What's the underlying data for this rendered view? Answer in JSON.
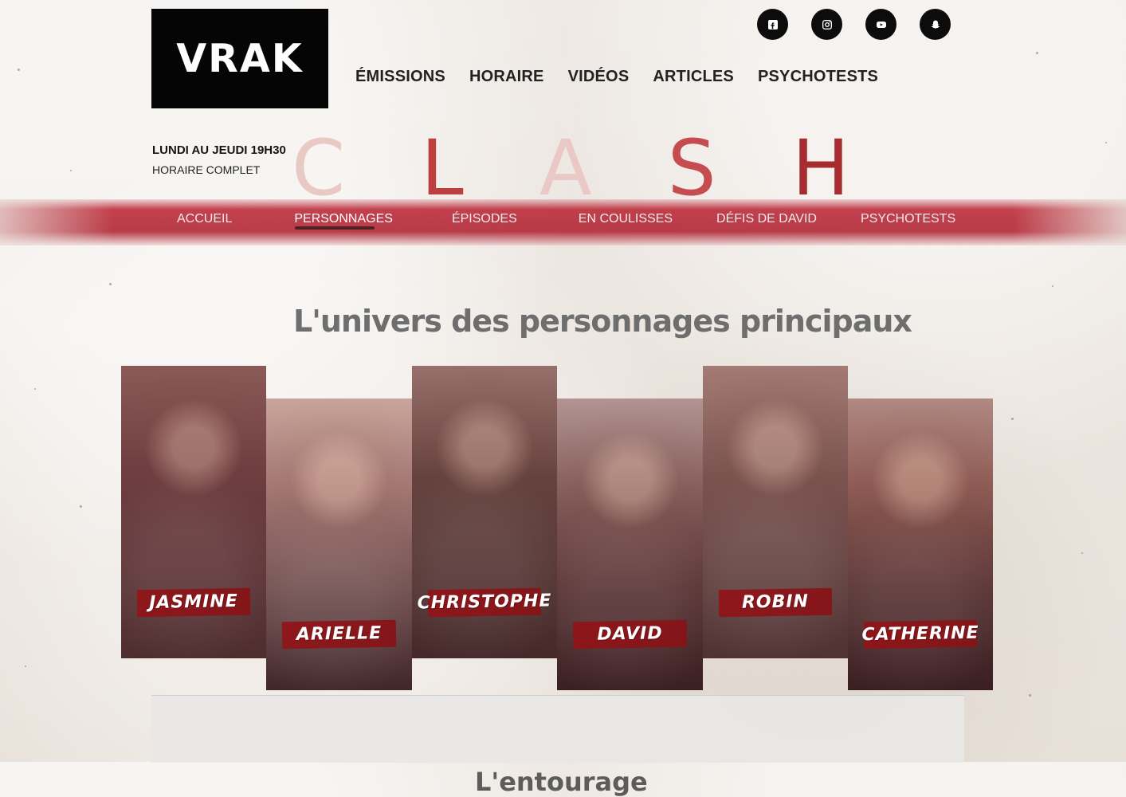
{
  "logo": {
    "text": "VRAK"
  },
  "main_nav": {
    "items": [
      {
        "label": "ÉMISSIONS"
      },
      {
        "label": "HORAIRE"
      },
      {
        "label": "VIDÉOS"
      },
      {
        "label": "ARTICLES"
      },
      {
        "label": "PSYCHOTESTS"
      }
    ]
  },
  "social": {
    "icons": [
      {
        "name": "facebook-icon"
      },
      {
        "name": "instagram-icon"
      },
      {
        "name": "youtube-icon"
      },
      {
        "name": "snapchat-icon"
      }
    ]
  },
  "schedule": {
    "day": "LUNDI AU JEUDI 19H30",
    "link": "HORAIRE COMPLET"
  },
  "show": {
    "title": "CLASH"
  },
  "sub_nav": {
    "items": [
      {
        "label": "ACCUEIL"
      },
      {
        "label": "PERSONNAGES"
      },
      {
        "label": "ÉPISODES"
      },
      {
        "label": "EN COULISSES"
      },
      {
        "label": "DÉFIS DE DAVID"
      },
      {
        "label": "PSYCHOTESTS"
      }
    ]
  },
  "section": {
    "title": "L'univers des personnages principaux"
  },
  "characters": [
    {
      "name": "JASMINE"
    },
    {
      "name": "ARIELLE"
    },
    {
      "name": "CHRISTOPHE"
    },
    {
      "name": "DAVID"
    },
    {
      "name": "ROBIN"
    },
    {
      "name": "CATHERINE"
    }
  ],
  "footer": {
    "heading": "L'entourage"
  },
  "colors": {
    "brand_red": "#b3262d",
    "text_gray": "#6e6e6e",
    "black": "#0c0c0c"
  }
}
